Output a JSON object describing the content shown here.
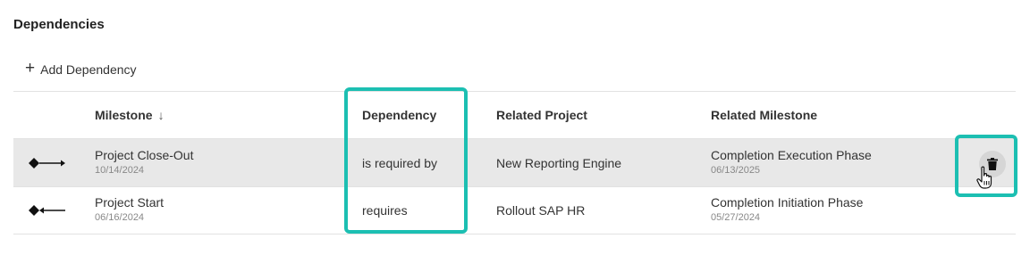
{
  "section": {
    "title": "Dependencies"
  },
  "toolbar": {
    "add_icon": "plus-icon",
    "add_label": "Add Dependency"
  },
  "table": {
    "headers": {
      "milestone": "Milestone",
      "milestone_sort_icon": "arrow-down-icon",
      "dependency": "Dependency",
      "related_project": "Related Project",
      "related_milestone": "Related Milestone"
    },
    "rows": [
      {
        "icon": "dependency-forward-icon",
        "milestone": "Project Close-Out",
        "milestone_date": "10/14/2024",
        "dependency": "is required by",
        "related_project": "New Reporting Engine",
        "related_milestone": "Completion Execution Phase",
        "related_milestone_date": "06/13/2025",
        "hovered": true,
        "action_icon": "trash-icon"
      },
      {
        "icon": "dependency-backward-icon",
        "milestone": "Project Start",
        "milestone_date": "06/16/2024",
        "dependency": "requires",
        "related_project": "Rollout SAP HR",
        "related_milestone": "Completion Initiation Phase",
        "related_milestone_date": "05/27/2024",
        "hovered": false
      }
    ]
  },
  "colors": {
    "highlight": "#1cbfb2",
    "row_hover": "#e8e8e8",
    "divider": "#e2e2e2"
  }
}
